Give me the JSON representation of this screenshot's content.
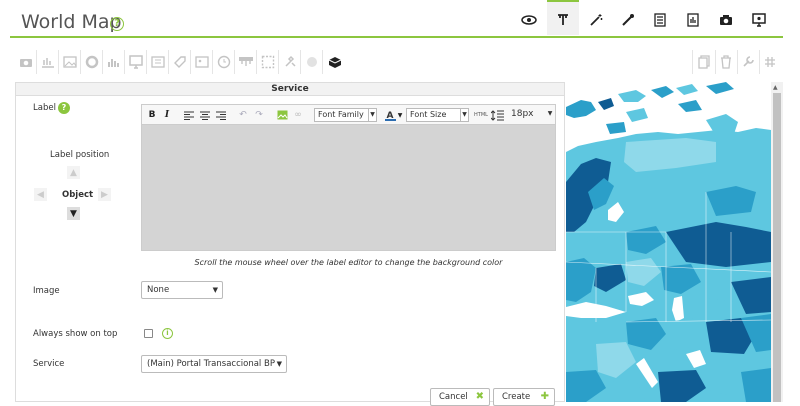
{
  "header": {
    "title": "World Map",
    "help": "?",
    "icons": [
      "view-icon",
      "text-tool-icon",
      "magic-wand-icon",
      "wand-icon",
      "list-icon",
      "report-icon",
      "camera-icon",
      "monitor-icon"
    ]
  },
  "toolbar": {
    "icons": [
      "camera-icon",
      "chart-icon",
      "image-icon",
      "circle-icon",
      "bar-chart-icon",
      "monitor-icon",
      "box-icon",
      "tag-icon",
      "picture-icon",
      "clock-icon",
      "network-icon",
      "selection-icon",
      "wrench-icon",
      "sphere-icon",
      "cloud-icon",
      "copy-icon",
      "trash-icon",
      "settings-icon",
      "grid-icon"
    ]
  },
  "panel": {
    "title": "Service",
    "label_field": "Label",
    "label_help": "?",
    "label_position": "Label position",
    "position_value": "Object",
    "editor": {
      "bold": "B",
      "italic": "I",
      "font_family": "Font Family",
      "font_size": "Font Size",
      "size_value": "18px"
    },
    "hint": "Scroll the mouse wheel over the label editor to change the background color",
    "image_label": "Image",
    "image_value": "None",
    "always_on_top_label": "Always show on top",
    "service_label": "Service",
    "service_value": "(Main) Portal Transaccional BP",
    "cancel": "Cancel",
    "create": "Create"
  },
  "colors": {
    "accent": "#8cc63f",
    "map_light": "#5ec7e0",
    "map_mid": "#2b9fc9",
    "map_dark": "#0f5c93"
  }
}
